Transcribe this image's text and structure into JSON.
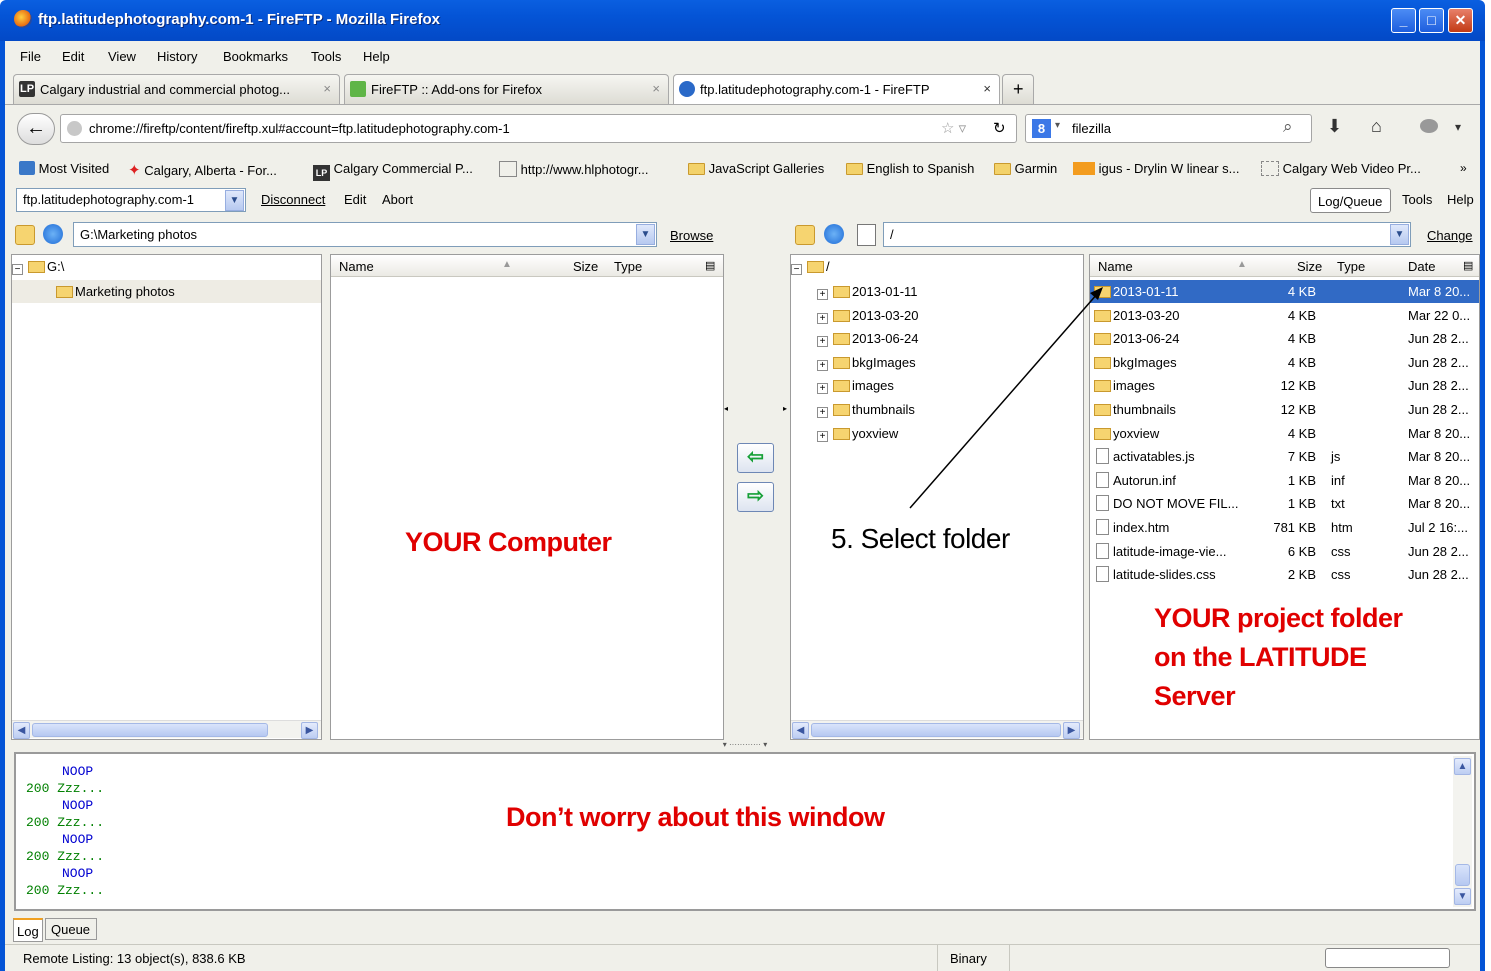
{
  "window": {
    "title": "ftp.latitudephotography.com-1 - FireFTP - Mozilla Firefox"
  },
  "menubar": [
    "File",
    "Edit",
    "View",
    "History",
    "Bookmarks",
    "Tools",
    "Help"
  ],
  "tabs": [
    {
      "label": "Calgary industrial and commercial photog..."
    },
    {
      "label": "FireFTP :: Add-ons for Firefox"
    },
    {
      "label": "ftp.latitudephotography.com-1 - FireFTP"
    }
  ],
  "nav": {
    "url": "chrome://fireftp/content/fireftp.xul#account=ftp.latitudephotography.com-1",
    "search": "filezilla"
  },
  "bookmarks": [
    "Most Visited",
    "Calgary, Alberta - For...",
    "Calgary Commercial P...",
    "http://www.hlphotogr...",
    "JavaScript Galleries",
    "English to Spanish",
    "Garmin",
    "igus - Drylin W linear s...",
    "Calgary Web Video Pr..."
  ],
  "ftpbar": {
    "account": "ftp.latitudephotography.com-1",
    "disconnect": "Disconnect",
    "edit": "Edit",
    "abort": "Abort",
    "logqueue": "Log/Queue",
    "tools": "Tools",
    "help": "Help"
  },
  "local": {
    "path": "G:\\Marketing photos",
    "browse": "Browse",
    "tree_root": "G:\\",
    "tree_child": "Marketing photos",
    "columns": {
      "name": "Name",
      "size": "Size",
      "type": "Type"
    }
  },
  "remote": {
    "path": "/",
    "change": "Change",
    "tree_root": "/",
    "tree": [
      "2013-01-11",
      "2013-03-20",
      "2013-06-24",
      "bkgImages",
      "images",
      "thumbnails",
      "yoxview"
    ],
    "columns": {
      "name": "Name",
      "size": "Size",
      "type": "Type",
      "date": "Date"
    },
    "files": [
      {
        "name": "2013-01-11",
        "size": "4 KB",
        "type": "",
        "date": "Mar 8 20...",
        "kind": "folder"
      },
      {
        "name": "2013-03-20",
        "size": "4 KB",
        "type": "",
        "date": "Mar 22 0...",
        "kind": "folder"
      },
      {
        "name": "2013-06-24",
        "size": "4 KB",
        "type": "",
        "date": "Jun 28 2...",
        "kind": "folder"
      },
      {
        "name": "bkgImages",
        "size": "4 KB",
        "type": "",
        "date": "Jun 28 2...",
        "kind": "folder"
      },
      {
        "name": "images",
        "size": "12 KB",
        "type": "",
        "date": "Jun 28 2...",
        "kind": "folder"
      },
      {
        "name": "thumbnails",
        "size": "12 KB",
        "type": "",
        "date": "Jun 28 2...",
        "kind": "folder"
      },
      {
        "name": "yoxview",
        "size": "4 KB",
        "type": "",
        "date": "Mar 8 20...",
        "kind": "folder"
      },
      {
        "name": "activatables.js",
        "size": "7 KB",
        "type": "js",
        "date": "Mar 8 20...",
        "kind": "file"
      },
      {
        "name": "Autorun.inf",
        "size": "1 KB",
        "type": "inf",
        "date": "Mar 8 20...",
        "kind": "file"
      },
      {
        "name": "DO NOT MOVE FIL...",
        "size": "1 KB",
        "type": "txt",
        "date": "Mar 8 20...",
        "kind": "file"
      },
      {
        "name": "index.htm",
        "size": "781 KB",
        "type": "htm",
        "date": "Jul 2 16:...",
        "kind": "file"
      },
      {
        "name": "latitude-image-vie...",
        "size": "6 KB",
        "type": "css",
        "date": "Jun 28 2...",
        "kind": "file"
      },
      {
        "name": "latitude-slides.css",
        "size": "2 KB",
        "type": "css",
        "date": "Jun 28 2...",
        "kind": "file"
      }
    ]
  },
  "log": [
    "NOOP",
    "200 Zzz...",
    "NOOP",
    "200 Zzz...",
    "NOOP",
    "200 Zzz...",
    "NOOP",
    "200 Zzz..."
  ],
  "bottom_tabs": [
    "Log",
    "Queue"
  ],
  "status": {
    "text": "Remote Listing: 13 object(s), 838.6 KB",
    "mode": "Binary"
  },
  "annotations": {
    "computer": "YOUR Computer",
    "select": "5.  Select folder",
    "project": [
      "YOUR project folder",
      "on the LATITUDE",
      "Server"
    ],
    "log": "Don’t worry about this window"
  },
  "colors": {
    "annotation": "#e00000",
    "titlebar": "#0454d6",
    "selection": "#316ac5"
  }
}
